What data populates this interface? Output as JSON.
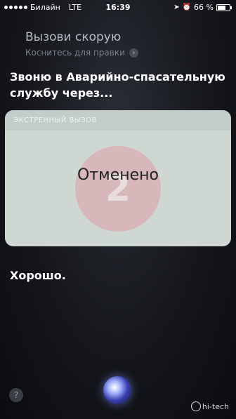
{
  "status_bar": {
    "carrier": "Билайн",
    "network": "LTE",
    "time": "16:39",
    "battery_percent": "66 %",
    "battery_level": 0.66
  },
  "siri": {
    "query": "Вызови скорую",
    "tap_to_edit": "Коснитесь для правки",
    "response": "Звоню в Аварийно-спасательную службу через...",
    "card": {
      "header": "ЭКСТРЕННЫЙ ВЫЗОВ",
      "countdown": "2",
      "status": "Отменено"
    },
    "reply": "Хорошо."
  },
  "help_label": "?",
  "watermark": "hi-tech"
}
